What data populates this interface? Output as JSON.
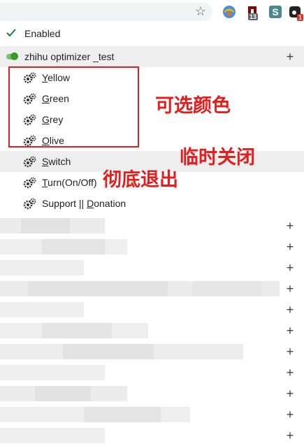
{
  "toolbar": {
    "star_icon": "star-icon",
    "extensions": [
      {
        "name": "colorful-ball-extension-icon"
      },
      {
        "name": "shield-extension-icon",
        "badge": "13"
      },
      {
        "name": "s-extension-icon"
      },
      {
        "name": "dark-extension-icon",
        "badge": "1"
      }
    ]
  },
  "menu": {
    "enabled_label": "Enabled",
    "header_label": "zhihu optimizer _test",
    "header_plus": "+",
    "items": [
      {
        "first": "Y",
        "rest": "ellow"
      },
      {
        "first": "G",
        "rest": "reen"
      },
      {
        "first": "G",
        "rest": "rey"
      },
      {
        "first": "O",
        "rest": "live"
      },
      {
        "first": "S",
        "rest": "witch"
      },
      {
        "first": "T",
        "rest": "urn(On/Off)"
      },
      {
        "pre": "Support || ",
        "first": "D",
        "rest": "onation"
      }
    ],
    "plus_symbol": "+"
  },
  "annotations": {
    "colors": "可选颜色",
    "temp_close": "临时关闭",
    "exit": "彻底退出",
    "color": "#e41d1d"
  }
}
